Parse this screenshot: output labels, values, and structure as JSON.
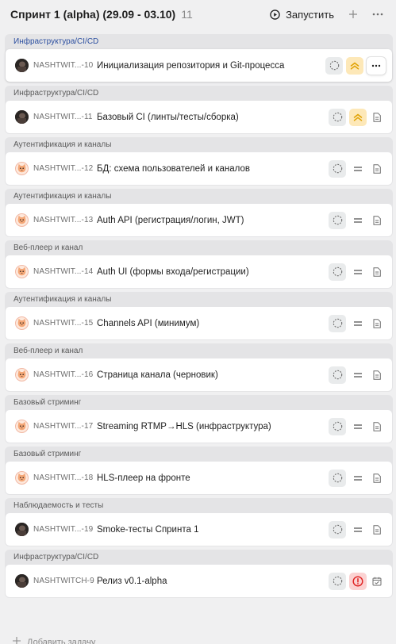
{
  "header": {
    "title": "Спринт 1 (alpha) (29.09 - 03.10)",
    "count": "11",
    "start_label": "Запустить"
  },
  "tasks": [
    {
      "group": "Инфраструктура/CI/CD",
      "group_color": "blue",
      "avatar": "dark",
      "key": "NASHTWIT...-10",
      "title": "Инициализация репозитория и Git-процесса",
      "status_icon": "dashed-circle-icon",
      "priority": "high",
      "type_icon": "more-icon"
    },
    {
      "group": "Инфраструктура/CI/CD",
      "group_color": "gray",
      "avatar": "dark",
      "key": "NASHTWIT...-11",
      "title": "Базовый CI (линты/тесты/сборка)",
      "status_icon": "dashed-circle-icon",
      "priority": "high",
      "type_icon": "document-icon"
    },
    {
      "group": "Аутентификация и каналы",
      "group_color": "gray",
      "avatar": "cat",
      "key": "NASHTWIT...-12",
      "title": "БД: схема пользователей и каналов",
      "status_icon": "dashed-circle-icon",
      "priority": "normal",
      "type_icon": "document-icon"
    },
    {
      "group": "Аутентификация и каналы",
      "group_color": "gray",
      "avatar": "cat",
      "key": "NASHTWIT...-13",
      "title": "Auth API (регистрация/логин, JWT)",
      "status_icon": "dashed-circle-icon",
      "priority": "normal",
      "type_icon": "document-icon"
    },
    {
      "group": "Веб-плеер и канал",
      "group_color": "gray",
      "avatar": "cat",
      "key": "NASHTWIT...-14",
      "title": "Auth UI (формы входа/регистрации)",
      "status_icon": "dashed-circle-icon",
      "priority": "normal",
      "type_icon": "document-icon"
    },
    {
      "group": "Аутентификация и каналы",
      "group_color": "gray",
      "avatar": "cat",
      "key": "NASHTWIT...-15",
      "title": "Channels API (минимум)",
      "status_icon": "dashed-circle-icon",
      "priority": "normal",
      "type_icon": "document-icon"
    },
    {
      "group": "Веб-плеер и канал",
      "group_color": "gray",
      "avatar": "cat",
      "key": "NASHTWIT...-16",
      "title": "Страница канала (черновик)",
      "status_icon": "dashed-circle-icon",
      "priority": "normal",
      "type_icon": "document-icon"
    },
    {
      "group": "Базовый стриминг",
      "group_color": "gray",
      "avatar": "cat",
      "key": "NASHTWIT...-17",
      "title": "Streaming RTMP→HLS (инфраструктура)",
      "status_icon": "dashed-circle-icon",
      "priority": "normal",
      "type_icon": "document-icon"
    },
    {
      "group": "Базовый стриминг",
      "group_color": "gray",
      "avatar": "cat",
      "key": "NASHTWIT...-18",
      "title": "HLS-плеер на фронте",
      "status_icon": "dashed-circle-icon",
      "priority": "normal",
      "type_icon": "document-icon"
    },
    {
      "group": "Наблюдаемость и тесты",
      "group_color": "gray",
      "avatar": "dark",
      "key": "NASHTWIT...-19",
      "title": "Smoke-тесты Спринта 1",
      "status_icon": "dashed-circle-icon",
      "priority": "normal",
      "type_icon": "document-icon"
    },
    {
      "group": "Инфраструктура/CI/CD",
      "group_color": "gray",
      "avatar": "dark",
      "key": "NASHTWITCH-9",
      "title": "Релиз v0.1-alpha",
      "status_icon": "dashed-circle-icon",
      "priority": "critical",
      "type_icon": "calendar-check-icon"
    }
  ],
  "footer": {
    "add_task_label": "Добавить задачу"
  },
  "colors": {
    "accent_blue": "#2c4fa0",
    "priority_high_bg": "#fde8b8",
    "priority_high_fg": "#e0a100",
    "priority_critical_bg": "#fbd2d2",
    "priority_critical_fg": "#e02020"
  }
}
